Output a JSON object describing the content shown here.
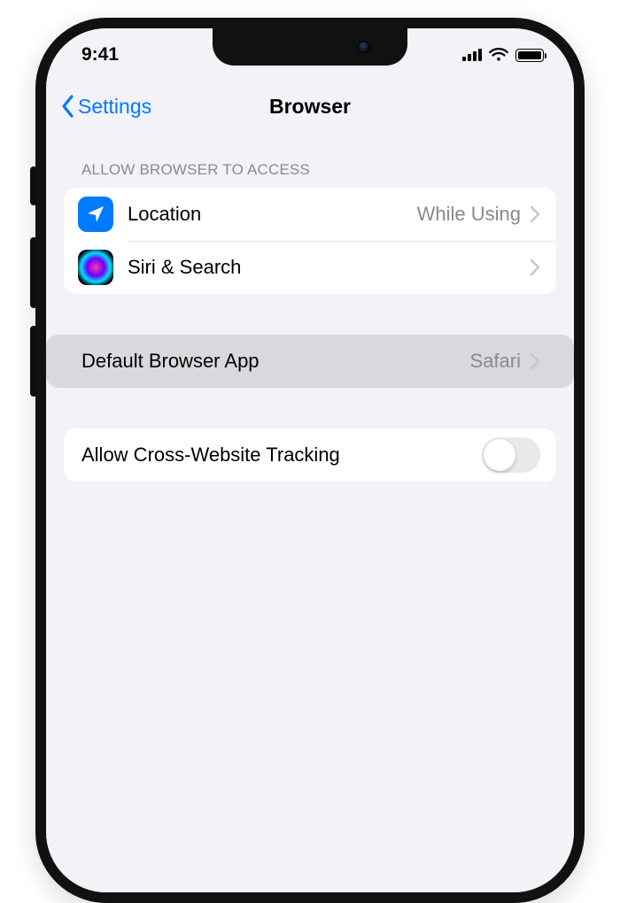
{
  "status": {
    "time": "9:41"
  },
  "nav": {
    "back_label": "Settings",
    "title": "Browser"
  },
  "section1": {
    "header": "ALLOW BROWSER TO ACCESS",
    "rows": [
      {
        "label": "Location",
        "value": "While Using"
      },
      {
        "label": "Siri & Search"
      }
    ]
  },
  "section2": {
    "row": {
      "label": "Default Browser App",
      "value": "Safari"
    }
  },
  "section3": {
    "row": {
      "label": "Allow Cross-Website Tracking",
      "toggle": false
    }
  }
}
